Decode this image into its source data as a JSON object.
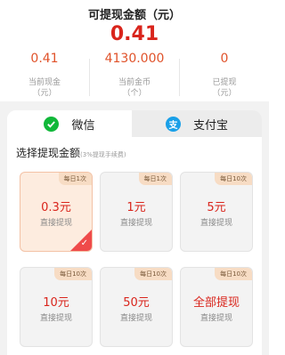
{
  "header": {
    "title": "可提现金额（元）",
    "amount": "0.41"
  },
  "stats": [
    {
      "value": "0.41",
      "label": "当前现金",
      "unit": "（元）"
    },
    {
      "value": "4130.000",
      "label": "当前金币",
      "unit": "（个）"
    },
    {
      "value": "0",
      "label": "已提现",
      "unit": "（元）"
    }
  ],
  "tabs": [
    {
      "label": "微信",
      "icon": "wechat-icon",
      "selected": true
    },
    {
      "label": "支付宝",
      "icon": "alipay-icon",
      "icon_glyph": "支",
      "selected": false
    }
  ],
  "section": {
    "title": "选择提现金额",
    "note": "(3%提现手续费)"
  },
  "options": [
    {
      "badge": "每日1次",
      "amount": "0.3元",
      "action": "直接提现",
      "selected": true
    },
    {
      "badge": "每日1次",
      "amount": "1元",
      "action": "直接提现",
      "selected": false
    },
    {
      "badge": "每日10次",
      "amount": "5元",
      "action": "直接提现",
      "selected": false
    },
    {
      "badge": "每日10次",
      "amount": "10元",
      "action": "直接提现",
      "selected": false
    },
    {
      "badge": "每日10次",
      "amount": "50元",
      "action": "直接提现",
      "selected": false
    },
    {
      "badge": "每日10次",
      "amount": "全部提现",
      "action": "直接提现",
      "selected": false
    }
  ],
  "colors": {
    "accent_red": "#d9251c",
    "stat_orange": "#e0522a",
    "wechat_green": "#11b83a",
    "alipay_blue": "#1aa0e8",
    "selected_card_bg": "#fdecdf"
  }
}
